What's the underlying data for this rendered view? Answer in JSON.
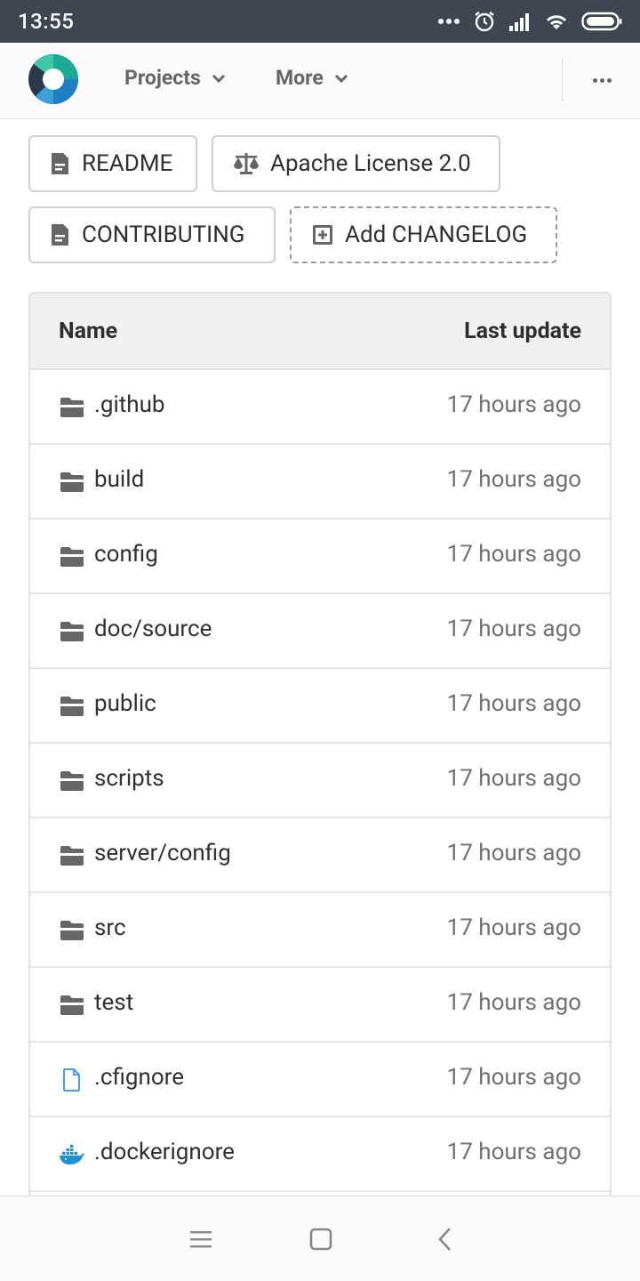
{
  "status_bar": {
    "time": "13:55"
  },
  "nav": {
    "projects_label": "Projects",
    "more_label": "More"
  },
  "file_buttons": {
    "readme": "README",
    "license": "Apache License 2.0",
    "contributing": "CONTRIBUTING",
    "add_changelog": "Add CHANGELOG"
  },
  "table": {
    "header": {
      "name": "Name",
      "last_update": "Last update"
    },
    "rows": [
      {
        "name": ".github",
        "type": "folder",
        "updated": "17 hours ago"
      },
      {
        "name": "build",
        "type": "folder",
        "updated": "17 hours ago"
      },
      {
        "name": "config",
        "type": "folder",
        "updated": "17 hours ago"
      },
      {
        "name": "doc/source",
        "type": "folder",
        "updated": "17 hours ago"
      },
      {
        "name": "public",
        "type": "folder",
        "updated": "17 hours ago"
      },
      {
        "name": "scripts",
        "type": "folder",
        "updated": "17 hours ago"
      },
      {
        "name": "server/config",
        "type": "folder",
        "updated": "17 hours ago"
      },
      {
        "name": "src",
        "type": "folder",
        "updated": "17 hours ago"
      },
      {
        "name": "test",
        "type": "folder",
        "updated": "17 hours ago"
      },
      {
        "name": ".cfignore",
        "type": "file",
        "updated": "17 hours ago"
      },
      {
        "name": ".dockerignore",
        "type": "docker-file",
        "updated": "17 hours ago"
      }
    ]
  },
  "colors": {
    "status_bar_bg": "#3f4650",
    "folder_icon": "#666666",
    "file_icon": "#4a9ee8",
    "docker_icon": "#1d91d6",
    "logo_teal": "#1aaa97",
    "logo_blue": "#1f7fc2",
    "logo_dark": "#2b3a4a"
  }
}
